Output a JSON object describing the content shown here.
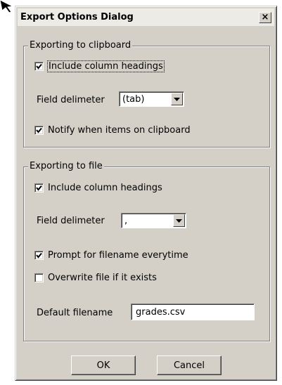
{
  "dialog": {
    "title": "Export Options Dialog",
    "close_label": "×"
  },
  "clipboard_group": {
    "legend": "Exporting to clipboard",
    "include_headings": {
      "label": "Include column headings",
      "checked": true
    },
    "delimiter": {
      "label": "Field delimeter",
      "value": "(tab)"
    },
    "notify": {
      "label": "Notify when items on clipboard",
      "checked": true
    }
  },
  "file_group": {
    "legend": "Exporting to file",
    "include_headings": {
      "label": "Include column headings",
      "checked": true
    },
    "delimiter": {
      "label": "Field delimeter",
      "value": ","
    },
    "prompt_filename": {
      "label": "Prompt for filename everytime",
      "checked": true
    },
    "overwrite": {
      "label": "Overwrite file if it exists",
      "checked": false
    },
    "default_filename": {
      "label": "Default filename",
      "value": "grades.csv"
    }
  },
  "buttons": {
    "ok": "OK",
    "cancel": "Cancel"
  },
  "colors": {
    "dialog_face": "#d4d0c8",
    "titlebar": "#ecebe6"
  },
  "icons": {
    "cursor": "arrow-cursor-icon",
    "close": "close-icon",
    "dropdown": "dropdown-arrow-icon",
    "check": "checkmark-icon"
  }
}
